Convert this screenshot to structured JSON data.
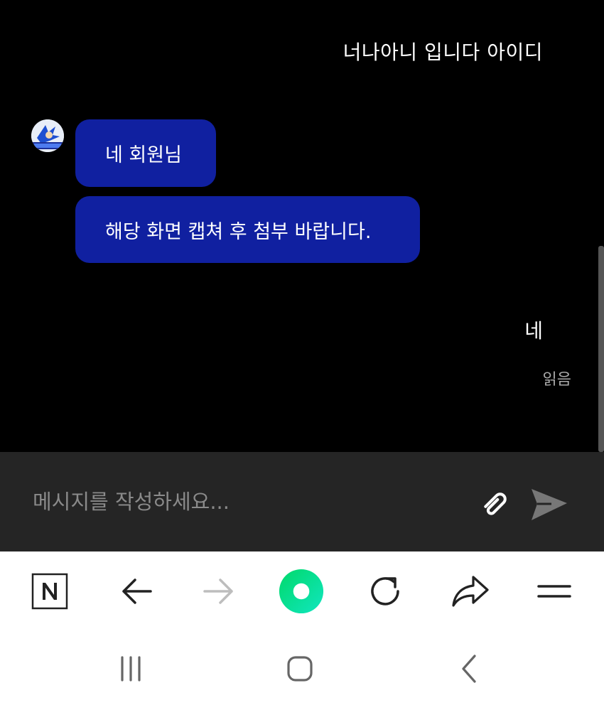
{
  "chat": {
    "messages": [
      {
        "direction": "outgoing",
        "text": "너나아니 입니다 아이디"
      },
      {
        "direction": "incoming",
        "text": "네 회원님"
      },
      {
        "direction": "incoming",
        "text": "해당 화면 캡쳐 후 첨부 바랍니다."
      },
      {
        "direction": "outgoing",
        "text": "네"
      }
    ],
    "read_receipt": "읽음"
  },
  "compose": {
    "placeholder": "메시지를 작성하세요...",
    "value": ""
  },
  "colors": {
    "incoming_bubble": "#1020a0",
    "background": "#000000",
    "compose_bar": "#252525",
    "home_accent": "#00e07a"
  },
  "browser_toolbar": {
    "icons": [
      "naver-n-icon",
      "back-arrow-icon",
      "forward-arrow-icon",
      "home-icon",
      "refresh-icon",
      "share-icon",
      "menu-icon"
    ]
  },
  "system_nav": {
    "icons": [
      "recent-apps-icon",
      "home-nav-icon",
      "back-nav-icon"
    ]
  }
}
